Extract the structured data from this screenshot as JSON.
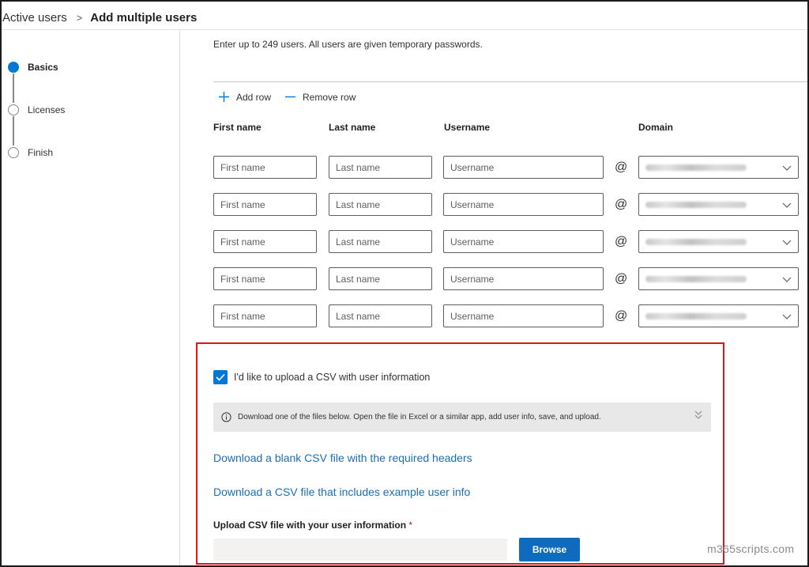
{
  "breadcrumb": {
    "parent": "Active users",
    "separator": ">",
    "current": "Add multiple users"
  },
  "steps": [
    {
      "label": "Basics",
      "active": true
    },
    {
      "label": "Licenses",
      "active": false
    },
    {
      "label": "Finish",
      "active": false
    }
  ],
  "intro": "Enter up to 249 users. All users are given temporary passwords.",
  "toolbar": {
    "add_row": "Add row",
    "remove_row": "Remove row"
  },
  "columns": {
    "first_name": "First name",
    "last_name": "Last name",
    "username": "Username",
    "domain": "Domain"
  },
  "rows": [
    {
      "first_placeholder": "First name",
      "last_placeholder": "Last name",
      "username_placeholder": "Username",
      "at": "@"
    },
    {
      "first_placeholder": "First name",
      "last_placeholder": "Last name",
      "username_placeholder": "Username",
      "at": "@"
    },
    {
      "first_placeholder": "First name",
      "last_placeholder": "Last name",
      "username_placeholder": "Username",
      "at": "@"
    },
    {
      "first_placeholder": "First name",
      "last_placeholder": "Last name",
      "username_placeholder": "Username",
      "at": "@"
    },
    {
      "first_placeholder": "First name",
      "last_placeholder": "Last name",
      "username_placeholder": "Username",
      "at": "@"
    }
  ],
  "csv": {
    "checkbox_label": "I'd like to upload a CSV with user information",
    "checked": true,
    "info": "Download one of the files below. Open the file in Excel or a similar app, add user info, save, and upload.",
    "link_blank": "Download a blank CSV file with the required headers",
    "link_example": "Download a CSV file that includes example user info",
    "upload_label": "Upload CSV file with your user information",
    "required_mark": "*",
    "browse_label": "Browse"
  },
  "watermark": "m365scripts.com",
  "colors": {
    "accent": "#0078d4",
    "link": "#1a6fb5",
    "highlight_border": "#e0151b",
    "button": "#0f6cbd"
  }
}
